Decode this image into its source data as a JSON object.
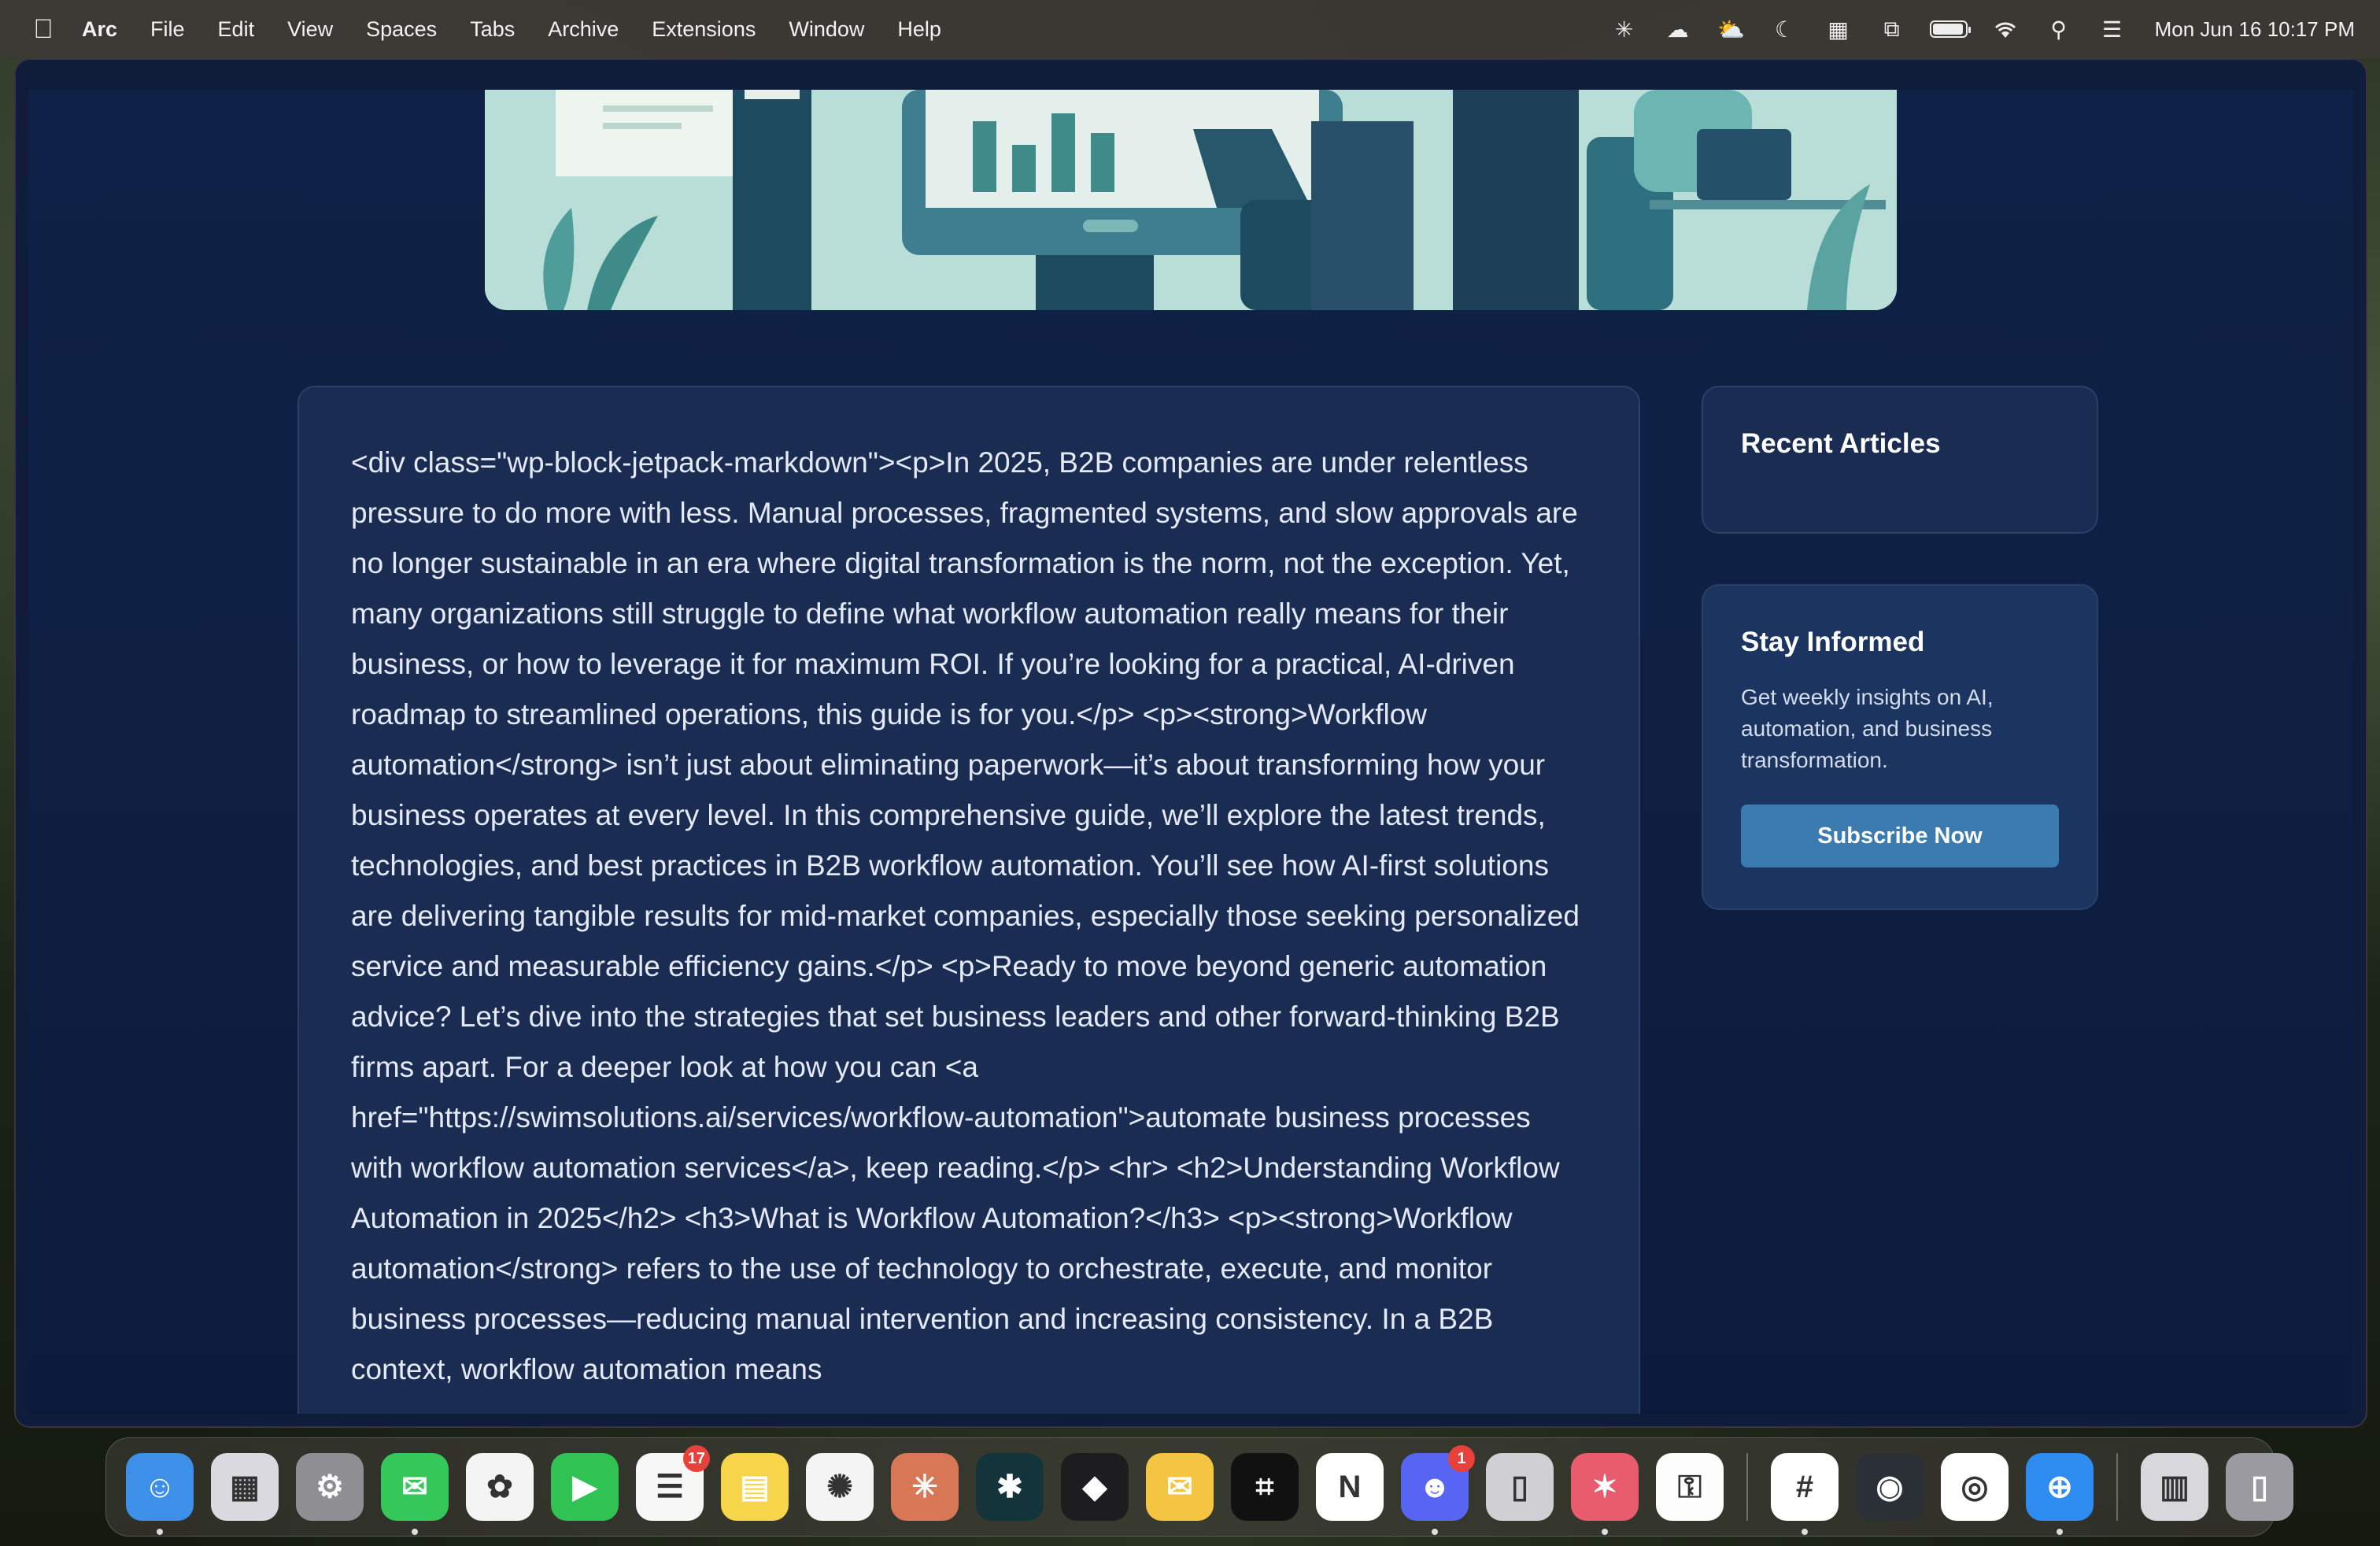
{
  "menubar": {
    "app_name": "Arc",
    "items": [
      "File",
      "Edit",
      "View",
      "Spaces",
      "Tabs",
      "Archive",
      "Extensions",
      "Window",
      "Help"
    ],
    "clock": "Mon Jun 16  10:17 PM",
    "battery_level": 0.95
  },
  "article": {
    "body": "<div class=\"wp-block-jetpack-markdown\"><p>In 2025, B2B companies are under relentless pressure to do more with less. Manual processes, fragmented systems, and slow approvals are no longer sustainable in an era where digital transformation is the norm, not the exception. Yet, many organizations still struggle to define what workflow automation really means for their business, or how to leverage it for maximum ROI. If you’re looking for a practical, AI-driven roadmap to streamlined operations, this guide is for you.</p> <p><strong>Workflow automation</strong> isn’t just about eliminating paperwork—it’s about transforming how your business operates at every level. In this comprehensive guide, we’ll explore the latest trends, technologies, and best practices in B2B workflow automation. You’ll see how AI-first solutions are delivering tangible results for mid-market companies, especially those seeking personalized service and measurable efficiency gains.</p> <p>Ready to move beyond generic automation advice? Let’s dive into the strategies that set business leaders and other forward-thinking B2B firms apart. For a deeper look at how you can <a href=\"https://swimsolutions.ai/services/workflow-automation\">automate business processes with workflow automation services</a>, keep reading.</p> <hr> <h2>Understanding Workflow Automation in 2025</h2> <h3>What is Workflow Automation?</h3> <p><strong>Workflow automation</strong> refers to the use of technology to orchestrate, execute, and monitor business processes—reducing manual intervention and increasing consistency. In a B2B context, workflow automation means"
  },
  "sidebar": {
    "recent_title": "Recent Articles",
    "informed_title": "Stay Informed",
    "informed_desc": "Get weekly insights on AI, automation, and business transformation.",
    "subscribe_label": "Subscribe Now"
  },
  "dock": {
    "apps": [
      {
        "name": "finder",
        "color": "#3d8fe8"
      },
      {
        "name": "launchpad",
        "color": "#d9d9df"
      },
      {
        "name": "system-settings",
        "color": "#8e8e93"
      },
      {
        "name": "messages",
        "color": "#34c759"
      },
      {
        "name": "photos",
        "color": "#f4f4f4"
      },
      {
        "name": "facetime",
        "color": "#30c253"
      },
      {
        "name": "reminders",
        "color": "#f7f7f7",
        "badge": "17"
      },
      {
        "name": "notes",
        "color": "#f6d54a"
      },
      {
        "name": "chatgpt",
        "color": "#f4f4f4"
      },
      {
        "name": "claude",
        "color": "#d87756"
      },
      {
        "name": "perplexity",
        "color": "#13343b"
      },
      {
        "name": "mirror-app",
        "color": "#1d1d1f"
      },
      {
        "name": "mail-app",
        "color": "#f4c542"
      },
      {
        "name": "screenshot-app",
        "color": "#111111"
      },
      {
        "name": "notion",
        "color": "#ffffff"
      },
      {
        "name": "discord",
        "color": "#5865f2",
        "badge": "1"
      },
      {
        "name": "iphone-mirroring",
        "color": "#cfcfd4"
      },
      {
        "name": "creative-app",
        "color": "#e85c6d"
      },
      {
        "name": "password-app",
        "color": "#fdfdfd"
      },
      {
        "name": "slack",
        "color": "#ffffff"
      },
      {
        "name": "obs",
        "color": "#2b2f36"
      },
      {
        "name": "chrome",
        "color": "#ffffff"
      },
      {
        "name": "safari",
        "color": "#2e8cf0"
      },
      {
        "name": "downloads-folder",
        "color": "#d8d8dc"
      },
      {
        "name": "trash",
        "color": "#9a9aa0"
      }
    ]
  }
}
